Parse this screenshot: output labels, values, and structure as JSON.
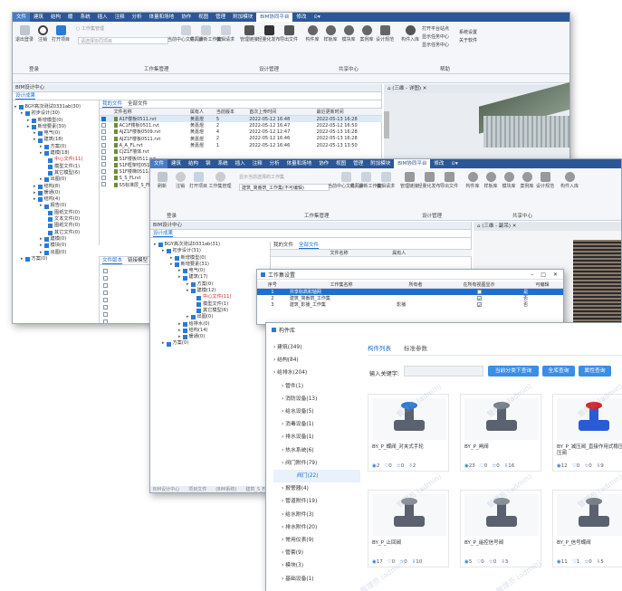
{
  "win1": {
    "menu": [
      "文件",
      "建筑",
      "结构",
      "暖",
      "系统",
      "插入",
      "注释",
      "分析",
      "体量和场地",
      "协作",
      "视图",
      "管理",
      "附加模块",
      "BIM协同平台",
      "修改"
    ],
    "ribbon_btns": [
      "退出登录",
      "注销",
      "打开项目",
      "工作集管理",
      "当前中心文件同步",
      "载入最新工作集",
      "编辑请求",
      "管理链接",
      "轻量化发布",
      "导出文件",
      "构件库",
      "样板库",
      "模块库",
      "案例库",
      "设计规范",
      "构件入库",
      "打开平台站点",
      "显示任务中心",
      "显示任务中心",
      "系统设置",
      "关于软件"
    ],
    "project_placeholder": "请选择协同项目",
    "groups": [
      "登录",
      "工作集管理",
      "设计管理",
      "共享中心",
      "帮助"
    ],
    "panel_title": "BIM设计中心",
    "panel_tab": "设计成果",
    "view_tab": "(三维 - 详图)",
    "file_tabs": [
      "我的文件",
      "全部文件"
    ],
    "file_headers": [
      "文件名称",
      "属有人",
      "当前版本",
      "首次上传时间",
      "最近更新时间"
    ],
    "files": [
      {
        "name": "A1F楼板0511.rvt",
        "owner": "黄嘉煜",
        "ver": "5",
        "first": "2022-05-12 16:48",
        "last": "2022-05-13 16:28",
        "checked": true
      },
      {
        "name": "AC1F楼板0511.rvt",
        "owner": "黄嘉煜",
        "ver": "2",
        "first": "2022-05-12 16:47",
        "last": "2022-05-12 16:50",
        "checked": false
      },
      {
        "name": "AJZ1F楼板0509.rvt",
        "owner": "黄嘉煜",
        "ver": "4",
        "first": "2022-05-12 12:47",
        "last": "2022-05-13 16:28",
        "checked": false
      },
      {
        "name": "AJZ1F楼板0511.rvt",
        "owner": "黄嘉煜",
        "ver": "2",
        "first": "2022-05-12 16:46",
        "last": "2022-05-13 16:28",
        "checked": false
      },
      {
        "name": "A_A_FL.rvt",
        "owner": "黄嘉煜",
        "ver": "1",
        "first": "2022-05-12 16:46",
        "last": "2022-05-13 13:50",
        "checked": false
      },
      {
        "name": "CJZ1F墙体.rvt",
        "owner": "",
        "ver": "",
        "first": "",
        "last": "",
        "checked": false
      },
      {
        "name": "S1F楼板0511.rvt",
        "owner": "",
        "ver": "",
        "first": "",
        "last": "",
        "checked": false
      },
      {
        "name": "S1F框架柱0511.rvt",
        "owner": "",
        "ver": "",
        "first": "",
        "last": "",
        "checked": false
      },
      {
        "name": "S1F楼梯0511.rvt",
        "owner": "",
        "ver": "",
        "first": "",
        "last": "",
        "checked": false
      },
      {
        "name": "S_S_FLrvt",
        "owner": "",
        "ver": "",
        "first": "",
        "last": "",
        "checked": false
      },
      {
        "name": "S5标准层_S_FL.rvt",
        "owner": "",
        "ver": "",
        "first": "",
        "last": "",
        "checked": false
      }
    ],
    "bottom_tabs": [
      "文件版本",
      "链接模型"
    ],
    "tree": [
      {
        "t": "BGY高次测试0331ab(30)",
        "lv": 0,
        "red": false
      },
      {
        "t": "初步设计(30)",
        "lv": 1,
        "red": false
      },
      {
        "t": "新增模型(0)",
        "lv": 2,
        "red": false
      },
      {
        "t": "新增要素(30)",
        "lv": 2,
        "red": false
      },
      {
        "t": "电气(0)",
        "lv": 3,
        "red": false
      },
      {
        "t": "建筑(18)",
        "lv": 3,
        "red": false
      },
      {
        "t": "方案(0)",
        "lv": 4,
        "red": false
      },
      {
        "t": "建模(18)",
        "lv": 4,
        "red": false
      },
      {
        "t": "中心文件(11)",
        "lv": 5,
        "red": true
      },
      {
        "t": "模型文件(1)",
        "lv": 5,
        "red": false
      },
      {
        "t": "其它模型(6)",
        "lv": 5,
        "red": false
      },
      {
        "t": "出图(0)",
        "lv": 4,
        "red": false
      },
      {
        "t": "结构(8)",
        "lv": 3,
        "red": false
      },
      {
        "t": "暖通(0)",
        "lv": 3,
        "red": false
      },
      {
        "t": "结构(4)",
        "lv": 3,
        "red": false
      },
      {
        "t": "报告(0)",
        "lv": 4,
        "red": false
      },
      {
        "t": "图纸文件(0)",
        "lv": 5,
        "red": false
      },
      {
        "t": "文本文件(0)",
        "lv": 5,
        "red": false
      },
      {
        "t": "图纸文件(0)",
        "lv": 5,
        "red": false
      },
      {
        "t": "其它文件(0)",
        "lv": 5,
        "red": false
      },
      {
        "t": "建模(0)",
        "lv": 4,
        "red": false
      },
      {
        "t": "模块(0)",
        "lv": 4,
        "red": false
      },
      {
        "t": "出图(0)",
        "lv": 4,
        "red": false
      },
      {
        "t": "方案(0)",
        "lv": 1,
        "red": false
      }
    ]
  },
  "win2": {
    "menu": [
      "文件",
      "建筑",
      "结构",
      "钢",
      "系统",
      "插入",
      "注释",
      "分析",
      "体量和场地",
      "协作",
      "视图",
      "管理",
      "附加模块",
      "BIM协同平台",
      "修改"
    ],
    "ribbon_btns": [
      "刷新",
      "注销",
      "打开项目",
      "工作集管理",
      "当前中心文件同步",
      "载入最新工作集",
      "编辑请求",
      "管理链接",
      "轻量化发布",
      "导出文件",
      "构件库",
      "样板库",
      "模块库",
      "案例库",
      "设计规范",
      "构件入库"
    ],
    "project_value": "建筑_简番筑_工作集(不可编辑)",
    "project_placeholder": "显示当前选择的工作集",
    "groups": [
      "登录",
      "工作集管理",
      "设计管理",
      "共享中心"
    ],
    "panel_title": "BIM设计中心",
    "panel_tab": "设计成果",
    "view_tab": "(三维 - 副吊)",
    "file_tabs": [
      "我的文件",
      "全部文件"
    ],
    "file_headers": [
      "文件名称",
      "属有人"
    ],
    "tree": [
      {
        "t": "BGY高次测试0331ab(31)",
        "lv": 0,
        "red": false
      },
      {
        "t": "初步设计(31)",
        "lv": 1,
        "red": false
      },
      {
        "t": "新增模型(0)",
        "lv": 2,
        "red": false
      },
      {
        "t": "新增要素(31)",
        "lv": 2,
        "red": false
      },
      {
        "t": "电气(0)",
        "lv": 3,
        "red": false
      },
      {
        "t": "建筑(17)",
        "lv": 3,
        "red": false
      },
      {
        "t": "方案(0)",
        "lv": 4,
        "red": false
      },
      {
        "t": "建模(12)",
        "lv": 4,
        "red": false
      },
      {
        "t": "中心文件(11)",
        "lv": 5,
        "red": true
      },
      {
        "t": "模型文件(1)",
        "lv": 5,
        "red": false
      },
      {
        "t": "其它模型(6)",
        "lv": 5,
        "red": false
      },
      {
        "t": "出图(0)",
        "lv": 4,
        "red": false
      },
      {
        "t": "给排水(0)",
        "lv": 3,
        "red": false
      },
      {
        "t": "结构(14)",
        "lv": 3,
        "red": false
      },
      {
        "t": "暖通(0)",
        "lv": 3,
        "red": false
      },
      {
        "t": "方案(0)",
        "lv": 1,
        "red": false
      }
    ],
    "status": [
      "BIM设计中心",
      "项目文件",
      "(BIM系统)",
      "建筑_S_FL.rvt"
    ]
  },
  "workset": {
    "title": "工作集设置",
    "headers": [
      "序号",
      "工作集名称",
      "所有者",
      "在所有视图显示",
      "可编辑"
    ],
    "rows": [
      {
        "n": "1",
        "name": "共享标高和轴网",
        "owner": "",
        "vis": true,
        "edit": "是",
        "sel": true
      },
      {
        "n": "2",
        "name": "建筑_简番筑_工作集",
        "owner": "",
        "vis": true,
        "edit": "否",
        "sel": false
      },
      {
        "n": "3",
        "name": "建筑_影播_工作集",
        "owner": "影播",
        "vis": true,
        "edit": "否",
        "sel": false
      }
    ]
  },
  "lib": {
    "title": "构件库",
    "categories": [
      {
        "t": "建筑(349)",
        "lv": 0
      },
      {
        "t": "结构(84)",
        "lv": 0
      },
      {
        "t": "给排水(204)",
        "lv": 0
      },
      {
        "t": "管件(1)",
        "lv": 1
      },
      {
        "t": "消防设备(13)",
        "lv": 1
      },
      {
        "t": "给水设备(5)",
        "lv": 1
      },
      {
        "t": "消毒设备(1)",
        "lv": 1
      },
      {
        "t": "排水设备(1)",
        "lv": 1
      },
      {
        "t": "热水系统(6)",
        "lv": 1
      },
      {
        "t": "阀门附件(79)",
        "lv": 1
      },
      {
        "t": "阀门(22)",
        "lv": 2
      },
      {
        "t": "报警器(4)",
        "lv": 1
      },
      {
        "t": "管道附件(19)",
        "lv": 1
      },
      {
        "t": "给水附件(3)",
        "lv": 1
      },
      {
        "t": "排水附件(20)",
        "lv": 1
      },
      {
        "t": "常用仪表(9)",
        "lv": 1
      },
      {
        "t": "管套(9)",
        "lv": 1
      },
      {
        "t": "模块(3)",
        "lv": 1
      },
      {
        "t": "基础设备(1)",
        "lv": 1
      }
    ],
    "tabs": [
      "构件列表",
      "标准参数"
    ],
    "search_label": "输入关键字:",
    "buttons": [
      "当前分类下查询",
      "全库查询",
      "属性查询"
    ],
    "cards": [
      {
        "name": "BY_P_蝶阀_对夹式手轮",
        "views": "2",
        "likes": "0",
        "stars": "0",
        "dl": "2"
      },
      {
        "name": "BY_P_闸阀",
        "views": "23",
        "likes": "0",
        "stars": "0",
        "dl": "16"
      },
      {
        "name": "BY_P_减压阀_直接作用式稳压减压阀",
        "views": "12",
        "likes": "0",
        "stars": "0",
        "dl": "9"
      },
      {
        "name": "BY_P_止回阀",
        "views": "17",
        "likes": "0",
        "stars": "0",
        "dl": "10"
      },
      {
        "name": "BY_P_遥控信号阀",
        "views": "5",
        "likes": "0",
        "stars": "0",
        "dl": "3"
      },
      {
        "name": "BY_P_信号蝶阀",
        "views": "11",
        "likes": "1",
        "stars": "0",
        "dl": "5"
      }
    ],
    "watermark": "管理员 (admin)"
  }
}
